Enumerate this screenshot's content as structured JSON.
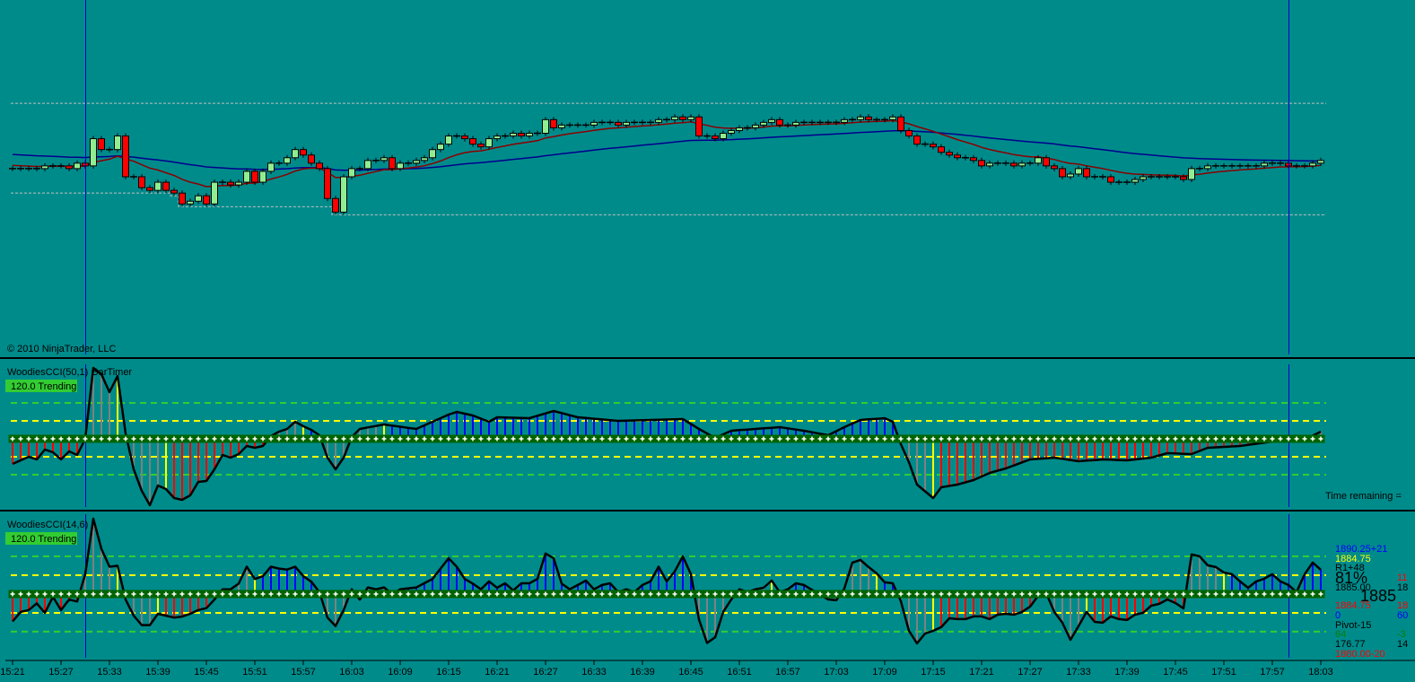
{
  "colors": {
    "background": "#008B8B",
    "up_candle": "#90EE90",
    "down_candle": "#FF0000",
    "sma_line": "#00008B",
    "ema_line": "#8B0000",
    "level_100": "#FFFF00",
    "level_200": "#32CD32",
    "hist_gray": "#808080",
    "hist_red": "#FF0000",
    "hist_blue": "#0000FF",
    "hist_yellow": "#FFFF00",
    "marker": "#006400",
    "session_line": "#0000CD"
  },
  "price_panel": {
    "copyright": "© 2010 NinjaTrader, LLC"
  },
  "cci_panel_1": {
    "label": "WoodiesCCI(50,1)",
    "label_suffix": "BarTimer",
    "badge": "120.0 Trending",
    "time_remaining": "Time remaining ="
  },
  "cci_panel_2": {
    "label": "WoodiesCCI(14,6)",
    "badge": "120.0 Trending"
  },
  "info_panel": {
    "col1": [
      {
        "text": "1890.25+21",
        "color": "#0000FF"
      },
      {
        "text": "1884.75",
        "color": "#FFFF00"
      },
      {
        "text": "R1+48",
        "color": "#000000"
      },
      {
        "text": "81%",
        "color": "#000000",
        "big": true
      },
      {
        "text": "1885.00",
        "color": "#000000"
      },
      {
        "text": "1885",
        "color": "#000000",
        "big": true
      },
      {
        "text": "1884.75",
        "color": "#FF0000"
      },
      {
        "text": "0",
        "color": "#0000FF"
      },
      {
        "text": "Pivot-15",
        "color": "#000000"
      },
      {
        "text": "64",
        "color": "#008000"
      },
      {
        "text": "176.77",
        "color": "#000000"
      },
      {
        "text": "1880.00-20",
        "color": "#FF0000"
      }
    ],
    "col2": [
      {
        "text": "11",
        "color": "#FF0000"
      },
      {
        "text": "18",
        "color": "#000000"
      },
      {
        "text": "18",
        "color": "#FF0000"
      },
      {
        "text": "60",
        "color": "#0000FF"
      },
      {
        "text": "-3",
        "color": "#008000"
      },
      {
        "text": "14",
        "color": "#000000"
      }
    ]
  },
  "chart_data": {
    "type": "candlestick",
    "title": "",
    "xlabel": "",
    "x_start": "15:21",
    "bar_interval_minutes": 1,
    "time_labels": [
      "15:21",
      "15:27",
      "15:33",
      "15:39",
      "15:45",
      "15:51",
      "15:57",
      "16:03",
      "16:09",
      "16:15",
      "16:21",
      "16:27",
      "16:33",
      "16:39",
      "16:45",
      "16:51",
      "16:57",
      "17:03",
      "17:09",
      "17:15",
      "17:21",
      "17:27",
      "17:33",
      "17:39",
      "17:45",
      "17:51",
      "17:57",
      "18:03"
    ],
    "time_label_every_bars": 6,
    "session_marker_bars": [
      9,
      158
    ],
    "price_ylim": [
      1867,
      1899.75
    ],
    "prior_high": 1890.25,
    "prior_low_seed": 1882.0,
    "closes": [
      1884.25,
      1884.25,
      1884.25,
      1884.25,
      1884.5,
      1884.5,
      1884.5,
      1884.25,
      1884.75,
      1884.5,
      1887,
      1886,
      1886,
      1887.25,
      1883.5,
      1883.5,
      1882.5,
      1882.25,
      1883,
      1882.25,
      1882,
      1881,
      1881.25,
      1881.75,
      1881,
      1883,
      1883,
      1882.75,
      1883,
      1884,
      1883,
      1884,
      1884.75,
      1884.75,
      1885.25,
      1886,
      1885.5,
      1884.75,
      1884.25,
      1881.5,
      1880.25,
      1883.5,
      1884.25,
      1884.25,
      1885,
      1885,
      1885.25,
      1884.25,
      1884.75,
      1884.75,
      1885,
      1885.25,
      1886,
      1886.5,
      1887.25,
      1887.25,
      1887,
      1886.5,
      1886.25,
      1887,
      1887.25,
      1887.25,
      1887.5,
      1887.25,
      1887.5,
      1887.5,
      1888.75,
      1888,
      1888.25,
      1888.25,
      1888.25,
      1888.25,
      1888.5,
      1888.5,
      1888.5,
      1888.25,
      1888.5,
      1888.5,
      1888.5,
      1888.5,
      1888.75,
      1888.75,
      1889,
      1888.75,
      1889,
      1887.25,
      1887.25,
      1887,
      1887.5,
      1887.75,
      1888,
      1888,
      1888.25,
      1888.5,
      1888.75,
      1888.25,
      1888.25,
      1888.5,
      1888.5,
      1888.5,
      1888.5,
      1888.5,
      1888.5,
      1888.75,
      1888.75,
      1889,
      1888.75,
      1888.75,
      1888.75,
      1889,
      1887.75,
      1887.25,
      1886.5,
      1886.5,
      1886.25,
      1885.75,
      1885.5,
      1885.25,
      1885.25,
      1885,
      1884.5,
      1884.75,
      1884.75,
      1884.75,
      1884.5,
      1884.75,
      1884.75,
      1885.25,
      1884.5,
      1884.25,
      1883.5,
      1883.75,
      1884.25,
      1883.5,
      1883.5,
      1883.5,
      1883,
      1883,
      1883,
      1883.25,
      1883.5,
      1883.5,
      1883.5,
      1883.5,
      1883.5,
      1883.25,
      1884.25,
      1884.25,
      1884.5,
      1884.5,
      1884.5,
      1884.5,
      1884.5,
      1884.5,
      1884.5,
      1884.75,
      1884.75,
      1884.75,
      1884.5,
      1884.5,
      1884.5,
      1884.75,
      1885
    ],
    "cci_1": {
      "ylim": [
        -395,
        445
      ],
      "levels": [
        -200,
        -100,
        100,
        200
      ],
      "keypoints": [
        [
          0,
          -140
        ],
        [
          1,
          -120
        ],
        [
          2,
          -100
        ],
        [
          3,
          -115
        ],
        [
          4,
          -60
        ],
        [
          5,
          -75
        ],
        [
          6,
          -115
        ],
        [
          7,
          -70
        ],
        [
          8,
          -90
        ],
        [
          9,
          0
        ],
        [
          10,
          395
        ],
        [
          11,
          360
        ],
        [
          12,
          260
        ],
        [
          13,
          350
        ],
        [
          14,
          30
        ],
        [
          15,
          -170
        ],
        [
          16,
          -290
        ],
        [
          17,
          -370
        ],
        [
          18,
          -260
        ],
        [
          19,
          -280
        ],
        [
          20,
          -330
        ],
        [
          21,
          -340
        ],
        [
          22,
          -315
        ],
        [
          23,
          -240
        ],
        [
          24,
          -235
        ],
        [
          25,
          -170
        ],
        [
          26,
          -90
        ],
        [
          27,
          -105
        ],
        [
          28,
          -85
        ],
        [
          29,
          -40
        ],
        [
          30,
          -50
        ],
        [
          31,
          -40
        ],
        [
          32,
          15
        ],
        [
          33,
          40
        ],
        [
          34,
          55
        ],
        [
          35,
          95
        ],
        [
          36,
          70
        ],
        [
          37,
          50
        ],
        [
          38,
          20
        ],
        [
          39,
          -105
        ],
        [
          40,
          -170
        ],
        [
          41,
          -105
        ],
        [
          42,
          10
        ],
        [
          43,
          55
        ],
        [
          46,
          80
        ],
        [
          50,
          55
        ],
        [
          54,
          135
        ],
        [
          55,
          150
        ],
        [
          57,
          130
        ],
        [
          59,
          95
        ],
        [
          60,
          120
        ],
        [
          64,
          115
        ],
        [
          67,
          155
        ],
        [
          70,
          120
        ],
        [
          75,
          100
        ],
        [
          83,
          110
        ],
        [
          85,
          55
        ],
        [
          87,
          5
        ],
        [
          89,
          45
        ],
        [
          92,
          55
        ],
        [
          95,
          65
        ],
        [
          98,
          45
        ],
        [
          101,
          20
        ],
        [
          103,
          65
        ],
        [
          105,
          105
        ],
        [
          108,
          115
        ],
        [
          109,
          95
        ],
        [
          110,
          -30
        ],
        [
          111,
          -130
        ],
        [
          112,
          -255
        ],
        [
          114,
          -330
        ],
        [
          115,
          -270
        ],
        [
          117,
          -255
        ],
        [
          119,
          -230
        ],
        [
          121,
          -190
        ],
        [
          123,
          -165
        ],
        [
          126,
          -115
        ],
        [
          129,
          -105
        ],
        [
          132,
          -125
        ],
        [
          135,
          -115
        ],
        [
          138,
          -120
        ],
        [
          141,
          -105
        ],
        [
          143,
          -80
        ],
        [
          146,
          -85
        ],
        [
          148,
          -50
        ],
        [
          152,
          -40
        ],
        [
          156,
          -15
        ],
        [
          160,
          -5
        ],
        [
          162,
          40
        ]
      ]
    },
    "cci_2": {
      "ylim": [
        -348,
        438
      ],
      "levels": [
        -200,
        -100,
        100,
        200
      ],
      "keypoints": [
        [
          0,
          -145
        ],
        [
          1,
          -95
        ],
        [
          2,
          -85
        ],
        [
          3,
          -50
        ],
        [
          4,
          -100
        ],
        [
          5,
          -15
        ],
        [
          6,
          -85
        ],
        [
          7,
          -30
        ],
        [
          8,
          -40
        ],
        [
          9,
          105
        ],
        [
          10,
          400
        ],
        [
          11,
          240
        ],
        [
          12,
          145
        ],
        [
          13,
          150
        ],
        [
          14,
          -30
        ],
        [
          15,
          -115
        ],
        [
          16,
          -165
        ],
        [
          17,
          -165
        ],
        [
          18,
          -105
        ],
        [
          19,
          -115
        ],
        [
          20,
          -125
        ],
        [
          21,
          -120
        ],
        [
          22,
          -105
        ],
        [
          23,
          -85
        ],
        [
          24,
          -75
        ],
        [
          25,
          -30
        ],
        [
          26,
          25
        ],
        [
          27,
          25
        ],
        [
          28,
          55
        ],
        [
          29,
          145
        ],
        [
          30,
          80
        ],
        [
          31,
          95
        ],
        [
          32,
          145
        ],
        [
          33,
          135
        ],
        [
          34,
          130
        ],
        [
          35,
          145
        ],
        [
          36,
          95
        ],
        [
          37,
          65
        ],
        [
          38,
          10
        ],
        [
          39,
          -125
        ],
        [
          40,
          -170
        ],
        [
          41,
          -85
        ],
        [
          42,
          25
        ],
        [
          43,
          -30
        ],
        [
          44,
          35
        ],
        [
          45,
          25
        ],
        [
          46,
          35
        ],
        [
          47,
          0
        ],
        [
          48,
          25
        ],
        [
          50,
          35
        ],
        [
          52,
          80
        ],
        [
          54,
          190
        ],
        [
          55,
          145
        ],
        [
          56,
          80
        ],
        [
          57,
          55
        ],
        [
          58,
          25
        ],
        [
          59,
          67
        ],
        [
          60,
          33
        ],
        [
          61,
          57
        ],
        [
          62,
          19
        ],
        [
          63,
          57
        ],
        [
          64,
          57
        ],
        [
          65,
          80
        ],
        [
          66,
          215
        ],
        [
          67,
          190
        ],
        [
          68,
          55
        ],
        [
          69,
          25
        ],
        [
          70,
          48
        ],
        [
          71,
          71
        ],
        [
          72,
          25
        ],
        [
          73,
          48
        ],
        [
          74,
          57
        ],
        [
          75,
          10
        ],
        [
          76,
          25
        ],
        [
          77,
          10
        ],
        [
          78,
          48
        ],
        [
          79,
          67
        ],
        [
          80,
          145
        ],
        [
          81,
          67
        ],
        [
          82,
          120
        ],
        [
          83,
          200
        ],
        [
          84,
          105
        ],
        [
          85,
          -135
        ],
        [
          86,
          -260
        ],
        [
          87,
          -230
        ],
        [
          88,
          -95
        ],
        [
          89,
          -29
        ],
        [
          90,
          25
        ],
        [
          91,
          10
        ],
        [
          92,
          25
        ],
        [
          93,
          33
        ],
        [
          94,
          71
        ],
        [
          95,
          10
        ],
        [
          96,
          25
        ],
        [
          97,
          57
        ],
        [
          98,
          48
        ],
        [
          101,
          -29
        ],
        [
          102,
          -33
        ],
        [
          103,
          29
        ],
        [
          104,
          167
        ],
        [
          105,
          181
        ],
        [
          106,
          143
        ],
        [
          107,
          110
        ],
        [
          108,
          62
        ],
        [
          109,
          57
        ],
        [
          110,
          -38
        ],
        [
          111,
          -195
        ],
        [
          112,
          -262
        ],
        [
          113,
          -210
        ],
        [
          114,
          -195
        ],
        [
          115,
          -176
        ],
        [
          116,
          -129
        ],
        [
          117,
          -133
        ],
        [
          118,
          -133
        ],
        [
          119,
          -119
        ],
        [
          120,
          -119
        ],
        [
          121,
          -133
        ],
        [
          122,
          -110
        ],
        [
          123,
          -105
        ],
        [
          124,
          -110
        ],
        [
          125,
          -95
        ],
        [
          126,
          -67
        ],
        [
          127,
          -10
        ],
        [
          128,
          5
        ],
        [
          129,
          -95
        ],
        [
          130,
          -152
        ],
        [
          131,
          -243
        ],
        [
          132,
          -171
        ],
        [
          133,
          -95
        ],
        [
          134,
          -148
        ],
        [
          135,
          -152
        ],
        [
          136,
          -119
        ],
        [
          137,
          -133
        ],
        [
          138,
          -138
        ],
        [
          139,
          -110
        ],
        [
          140,
          -100
        ],
        [
          141,
          -62
        ],
        [
          142,
          -52
        ],
        [
          143,
          -29
        ],
        [
          144,
          -48
        ],
        [
          145,
          -76
        ],
        [
          146,
          210
        ],
        [
          147,
          200
        ],
        [
          148,
          152
        ],
        [
          149,
          143
        ],
        [
          150,
          114
        ],
        [
          151,
          105
        ],
        [
          152,
          67
        ],
        [
          153,
          33
        ],
        [
          154,
          67
        ],
        [
          155,
          81
        ],
        [
          156,
          105
        ],
        [
          157,
          67
        ],
        [
          158,
          48
        ],
        [
          159,
          10
        ],
        [
          160,
          105
        ],
        [
          161,
          167
        ],
        [
          162,
          129
        ]
      ]
    }
  }
}
